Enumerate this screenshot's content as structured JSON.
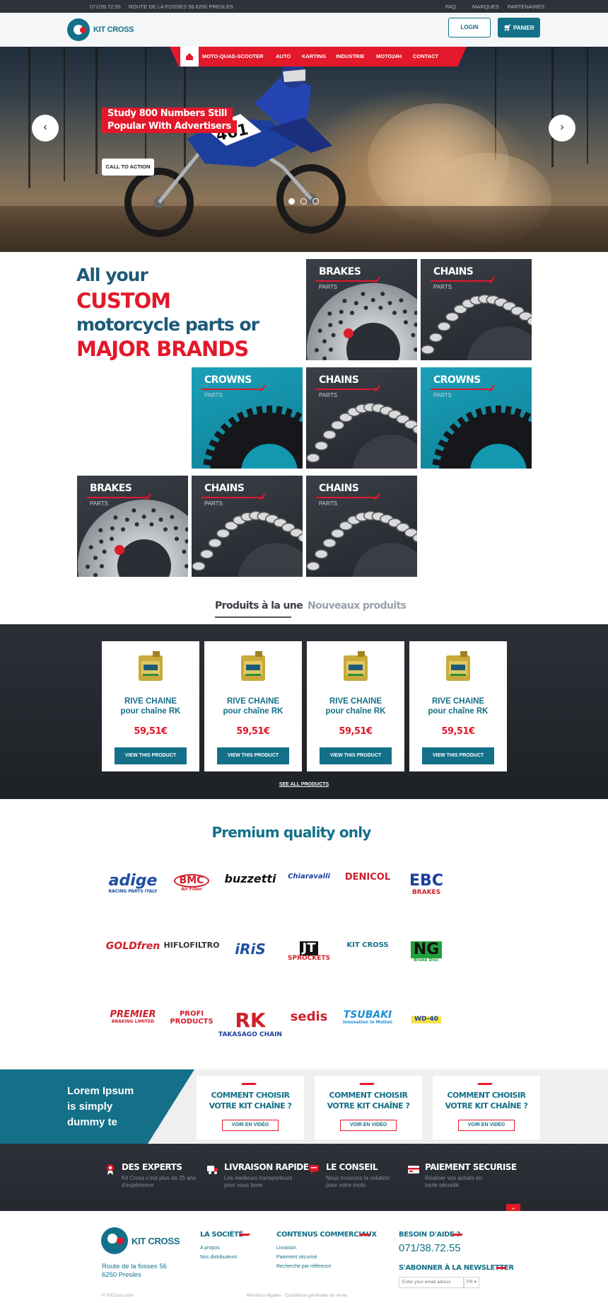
{
  "topbar": {
    "phone": "071/39.72.55",
    "address": "ROUTE DE LA FOSSES 56 6250 PRESLES",
    "links": [
      "FAQ",
      "MARQUES",
      "PARTENAIRES"
    ]
  },
  "header": {
    "logo_text": "KIT CROSS",
    "login_label": "LOGIN",
    "cart_label": "PANIER"
  },
  "nav": {
    "items": [
      "MOTO-QUAD-SCOOTER",
      "AUTO",
      "KARTING",
      "INDUSTRIE",
      "MOTO24H",
      "CONTACT"
    ]
  },
  "hero": {
    "title_line1": "Study 800 Numbers Still",
    "title_line2": "Popular With Advertisers",
    "cta_label": "CALL TO ACTION",
    "slides": 3,
    "active_slide": 1,
    "rider_number": "461"
  },
  "headline": {
    "line1": "All your",
    "line2": "CUSTOM",
    "line3": "motorcycle parts or",
    "line4": "MAJOR BRANDS"
  },
  "tiles": [
    {
      "title": "BRAKES",
      "sub": "PARTS",
      "kind": "brake",
      "color": "dark"
    },
    {
      "title": "CHAINS",
      "sub": "PARTS",
      "kind": "chain",
      "color": "dark"
    },
    {
      "title": "CROWNS",
      "sub": "PARTS",
      "kind": "crown",
      "color": "teal"
    },
    {
      "title": "CHAINS",
      "sub": "PARTS",
      "kind": "chain",
      "color": "dark"
    },
    {
      "title": "CROWNS",
      "sub": "PARTS",
      "kind": "crown",
      "color": "teal"
    },
    {
      "title": "BRAKES",
      "sub": "PARTS",
      "kind": "brake",
      "color": "dark"
    },
    {
      "title": "CHAINS",
      "sub": "PARTS",
      "kind": "chain",
      "color": "dark"
    },
    {
      "title": "CHAINS",
      "sub": "PARTS",
      "kind": "chain",
      "color": "dark"
    }
  ],
  "tabs": {
    "featured": "Produits à la une",
    "new": "Nouveaux produits"
  },
  "products": {
    "items": [
      {
        "name1": "RIVE CHAINE",
        "name2": "pour chaîne RK",
        "price": "59,51€",
        "button": "VIEW THIS PRODUCT"
      },
      {
        "name1": "RIVE CHAINE",
        "name2": "pour chaîne RK",
        "price": "59,51€",
        "button": "VIEW THIS PRODUCT"
      },
      {
        "name1": "RIVE CHAINE",
        "name2": "pour chaîne RK",
        "price": "59,51€",
        "button": "VIEW THIS PRODUCT"
      },
      {
        "name1": "RIVE CHAINE",
        "name2": "pour chaîne RK",
        "price": "59,51€",
        "button": "VIEW THIS PRODUCT"
      }
    ],
    "see_all": "SEE ALL PRODUCTS"
  },
  "brands": {
    "title": "Premium quality only",
    "items": [
      {
        "name": "adige",
        "sub": "RACING PARTS ITALY"
      },
      {
        "name": "BMC",
        "sub": "Air Filter"
      },
      {
        "name": "buzzetti",
        "sub": ""
      },
      {
        "name": "Chiaravalli",
        "sub": ""
      },
      {
        "name": "DENICOL",
        "sub": ""
      },
      {
        "name": "EBC",
        "sub": "BRAKES"
      },
      {
        "name": "GOLDfren",
        "sub": ""
      },
      {
        "name": "HIFLOFILTRO",
        "sub": ""
      },
      {
        "name": "iRiS",
        "sub": ""
      },
      {
        "name": "JT",
        "sub": "SPROCKETS"
      },
      {
        "name": "KIT CROSS",
        "sub": ""
      },
      {
        "name": "NG",
        "sub": "Brake Disc"
      },
      {
        "name": "PREMIER",
        "sub": "BRAKING LIMITED"
      },
      {
        "name": "PROFI PRODUCTS",
        "sub": ""
      },
      {
        "name": "RK",
        "sub": "TAKASAGO CHAIN"
      },
      {
        "name": "sedis",
        "sub": ""
      },
      {
        "name": "TSUBAKI",
        "sub": "Innovation in Motion"
      },
      {
        "name": "WD-40",
        "sub": ""
      }
    ]
  },
  "promo": {
    "text_line1": "Lorem Ipsum",
    "text_line2": "is simply",
    "text_line3": "dummy te",
    "cards": [
      {
        "line1": "COMMENT CHOISIR",
        "line2": "VOTRE KIT CHAÎNE ?",
        "button": "VOIR EN VIDÉO"
      },
      {
        "line1": "COMMENT CHOISIR",
        "line2": "VOTRE KIT CHAÎNE ?",
        "button": "VOIR EN VIDÉO"
      },
      {
        "line1": "COMMENT CHOISIR",
        "line2": "VOTRE KIT CHAÎNE ?",
        "button": "VOIR EN VIDÉO"
      }
    ]
  },
  "features": [
    {
      "title": "DES EXPERTS",
      "desc1": "Kit Cross c'est plus de 25 ans",
      "desc2": "d'expérience",
      "icon": "award-icon"
    },
    {
      "title": "LIVRAISON RAPIDE",
      "desc1": "Les meilleurs transporteurs",
      "desc2": "pour vous livrer",
      "icon": "truck-icon"
    },
    {
      "title": "LE CONSEIL",
      "desc1": "Nous trouvons la solution",
      "desc2": "pour votre moto",
      "icon": "chat-icon"
    },
    {
      "title": "PAIEMENT SECURISE",
      "desc1": "Réaliser vos achats en",
      "desc2": "toute sécurité",
      "icon": "card-icon"
    }
  ],
  "footer": {
    "logo_text": "KIT CROSS",
    "address1": "Route de la fosses 56",
    "address2": "6250 Presles",
    "col1_title": "LA SOCIÉTÉ",
    "col1_links": [
      "A propos",
      "Nos distributeurs"
    ],
    "col2_title": "CONTENUS COMMERCIAUX",
    "col2_links": [
      "Livraison",
      "Paiement sécurisé",
      "Recherche par référence"
    ],
    "help_title": "BESOIN D'AIDE ?",
    "help_phone": "071/38.72.55",
    "newsletter_title": "S'ABONNER À LA NEWSLETTER",
    "newsletter_placeholder": "Enter your email adress",
    "lang": "FR",
    "copyright": "© KitCross.com",
    "legal": "Mentions légales - Conditions générales de vente"
  },
  "colors": {
    "teal": "#147089",
    "red": "#e3182a",
    "dark": "#2e3138"
  }
}
